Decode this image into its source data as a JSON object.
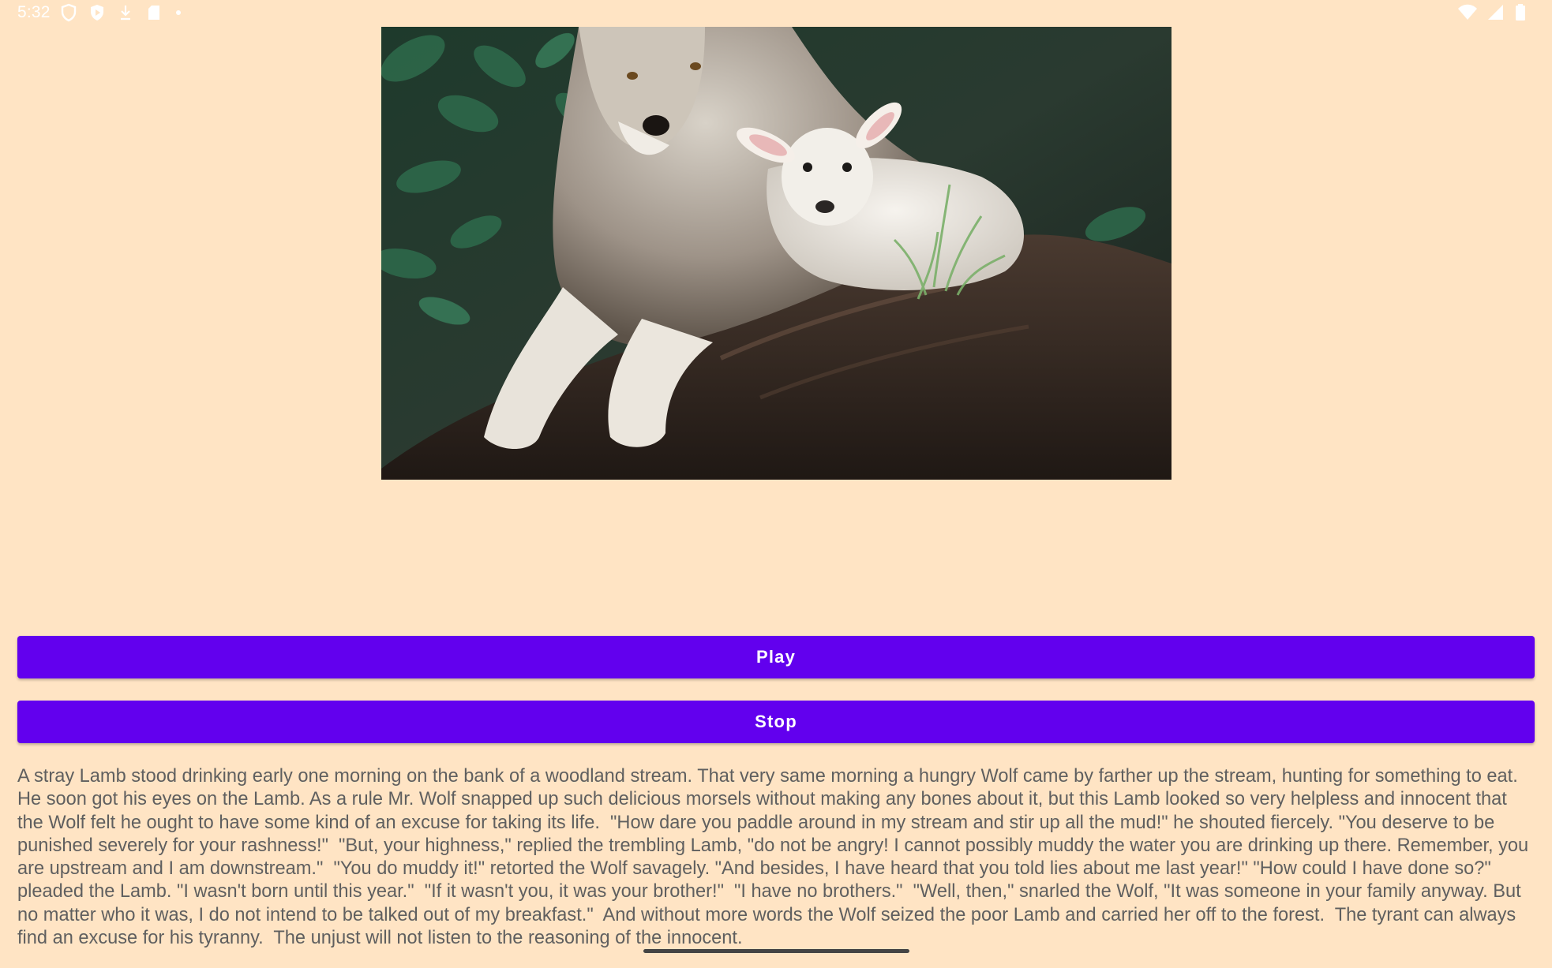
{
  "status_bar": {
    "time": "5:32",
    "left_icons": [
      "shield-icon",
      "play-protect-icon",
      "download-icon",
      "sd-card-icon",
      "dot-icon"
    ],
    "right_icons": [
      "wifi-icon",
      "cell-signal-icon",
      "battery-icon"
    ]
  },
  "story": {
    "image_subject": "wolf-and-lamb-image",
    "text": "A stray Lamb stood drinking early one morning on the bank of a woodland stream. That very same morning a hungry Wolf came by farther up the stream, hunting for something to eat. He soon got his eyes on the Lamb. As a rule Mr. Wolf snapped up such delicious morsels without making any bones about it, but this Lamb looked so very helpless and innocent that the Wolf felt he ought to have some kind of an excuse for taking its life.  \"How dare you paddle around in my stream and stir up all the mud!\" he shouted fiercely. \"You deserve to be punished severely for your rashness!\"  \"But, your highness,\" replied the trembling Lamb, \"do not be angry! I cannot possibly muddy the water you are drinking up there. Remember, you are upstream and I am downstream.\"  \"You do muddy it!\" retorted the Wolf savagely. \"And besides, I have heard that you told lies about me last year!\" \"How could I have done so?\" pleaded the Lamb. \"I wasn't born until this year.\"  \"If it wasn't you, it was your brother!\"  \"I have no brothers.\"  \"Well, then,\" snarled the Wolf, \"It was someone in your family anyway. But no matter who it was, I do not intend to be talked out of my breakfast.\"  And without more words the Wolf seized the poor Lamb and carried her off to the forest.  The tyrant can always find an excuse for his tyranny.  The unjust will not listen to the reasoning of the innocent."
  },
  "controls": {
    "play_label": "Play",
    "stop_label": "Stop"
  },
  "colors": {
    "background": "#FFE4C4",
    "button": "#6200EE",
    "button_text": "#FFFFFF",
    "story_text": "#5F5F5F"
  }
}
